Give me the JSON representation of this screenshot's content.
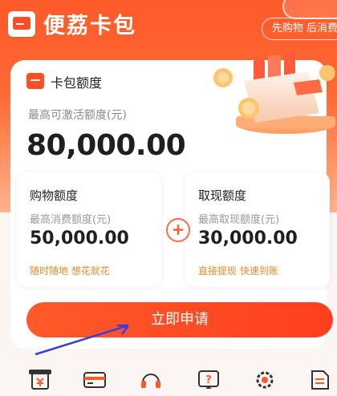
{
  "header": {
    "app_name": "便荔卡包",
    "slogan": "先购物 后消费"
  },
  "card": {
    "title": "卡包额度",
    "total_label": "最高可激活额度(元)",
    "total_value": "80,000.00"
  },
  "shopping": {
    "title": "购物额度",
    "label": "最高消费额度(元)",
    "value": "50,000.00",
    "tag": "随时随地 想花就花"
  },
  "cash": {
    "title": "取现额度",
    "label": "最高取现额度(元)",
    "value": "30,000.00",
    "tag": "直接提现 快速到账"
  },
  "plus_symbol": "+",
  "apply_button": "立即申请",
  "tabbar_icons": [
    "receipt-icon",
    "card-icon",
    "headset-icon",
    "help-icon",
    "settings-icon",
    "document-icon"
  ],
  "colors": {
    "brand": "#ff5a2a",
    "tag": "#f38a2b"
  }
}
